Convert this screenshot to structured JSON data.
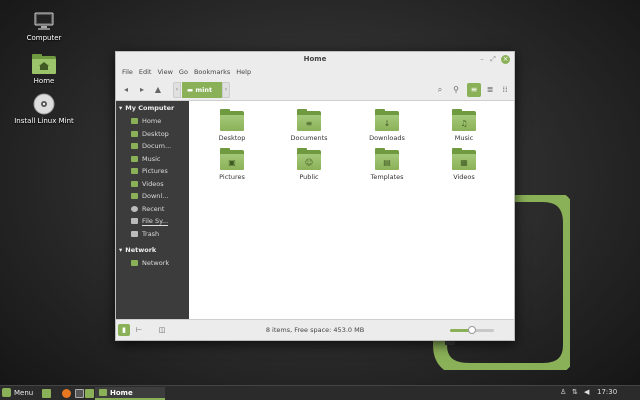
{
  "desktop": {
    "icons": [
      {
        "label": "Computer",
        "icon": "computer-icon"
      },
      {
        "label": "Home",
        "icon": "home-folder-icon"
      },
      {
        "label": "Install Linux Mint",
        "icon": "disc-icon"
      }
    ]
  },
  "window": {
    "title": "Home",
    "menus": [
      "File",
      "Edit",
      "View",
      "Go",
      "Bookmarks",
      "Help"
    ],
    "location": "mint",
    "sidebar": {
      "section_computer": "My Computer",
      "items": [
        {
          "label": "Home",
          "icon": "home-icon"
        },
        {
          "label": "Desktop",
          "icon": "desktop-icon"
        },
        {
          "label": "Docum...",
          "icon": "documents-icon"
        },
        {
          "label": "Music",
          "icon": "music-icon"
        },
        {
          "label": "Pictures",
          "icon": "pictures-icon"
        },
        {
          "label": "Videos",
          "icon": "videos-icon"
        },
        {
          "label": "Downl...",
          "icon": "downloads-icon"
        },
        {
          "label": "Recent",
          "icon": "recent-icon"
        },
        {
          "label": "File Sy...",
          "icon": "filesystem-icon"
        },
        {
          "label": "Trash",
          "icon": "trash-icon"
        }
      ],
      "section_network": "Network",
      "network_items": [
        {
          "label": "Network",
          "icon": "network-icon"
        }
      ]
    },
    "files": [
      {
        "label": "Desktop",
        "glyph": ""
      },
      {
        "label": "Documents",
        "glyph": "≡"
      },
      {
        "label": "Downloads",
        "glyph": "↓"
      },
      {
        "label": "Music",
        "glyph": "♫"
      },
      {
        "label": "Pictures",
        "glyph": "▣"
      },
      {
        "label": "Public",
        "glyph": "☺"
      },
      {
        "label": "Templates",
        "glyph": "▤"
      },
      {
        "label": "Videos",
        "glyph": "▦"
      }
    ],
    "status": "8 items, Free space: 453.0 MB",
    "zoom_level": 0.5
  },
  "panel": {
    "menu_label": "Menu",
    "task_label": "Home",
    "clock": "17:30"
  },
  "colors": {
    "accent": "#8bb158",
    "folder_dark": "#6f9a3f",
    "sidebar_bg": "#3c3c3c",
    "panel_bg": "#2b2b2b"
  }
}
